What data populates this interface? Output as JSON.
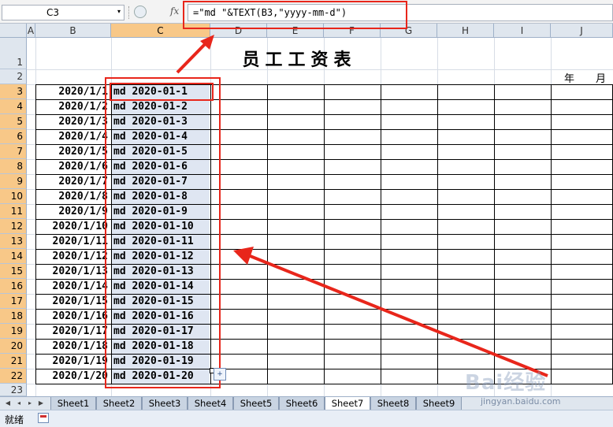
{
  "formula_bar": {
    "cell_ref": "C3",
    "dropdown_glyph": "▾",
    "fx_label": "fx",
    "formula": "=\"md \"&TEXT(B3,\"yyyy-mm-d\")"
  },
  "columns": [
    "A",
    "B",
    "C",
    "D",
    "E",
    "F",
    "G",
    "H",
    "I",
    "J"
  ],
  "selected_column": "C",
  "rows": [
    "1",
    "2",
    "3",
    "4",
    "5",
    "6",
    "7",
    "8",
    "9",
    "10",
    "11",
    "12",
    "13",
    "14",
    "15",
    "16",
    "17",
    "18",
    "19",
    "20",
    "21",
    "22",
    "23"
  ],
  "sheet": {
    "title": "员工工资表",
    "year_month_labels": [
      "年",
      "月"
    ],
    "dates": [
      "2020/1/1",
      "2020/1/2",
      "2020/1/3",
      "2020/1/4",
      "2020/1/5",
      "2020/1/6",
      "2020/1/7",
      "2020/1/8",
      "2020/1/9",
      "2020/1/10",
      "2020/1/11",
      "2020/1/12",
      "2020/1/13",
      "2020/1/14",
      "2020/1/15",
      "2020/1/16",
      "2020/1/17",
      "2020/1/18",
      "2020/1/19",
      "2020/1/20"
    ],
    "formatted": [
      "md 2020-01-1",
      "md 2020-01-2",
      "md 2020-01-3",
      "md 2020-01-4",
      "md 2020-01-5",
      "md 2020-01-6",
      "md 2020-01-7",
      "md 2020-01-8",
      "md 2020-01-9",
      "md 2020-01-10",
      "md 2020-01-11",
      "md 2020-01-12",
      "md 2020-01-13",
      "md 2020-01-14",
      "md 2020-01-15",
      "md 2020-01-16",
      "md 2020-01-17",
      "md 2020-01-18",
      "md 2020-01-19",
      "md 2020-01-20"
    ]
  },
  "tabs": [
    "Sheet1",
    "Sheet2",
    "Sheet3",
    "Sheet4",
    "Sheet5",
    "Sheet6",
    "Sheet7",
    "Sheet8",
    "Sheet9"
  ],
  "active_tab": "Sheet7",
  "nav_buttons": [
    "first-sheet-icon",
    "prev-sheet-icon",
    "next-sheet-icon",
    "last-sheet-icon"
  ],
  "status": {
    "ready": "就绪"
  },
  "watermark": {
    "logo": "Baidu 经验",
    "url": "jingyan.baidu.com"
  },
  "colors": {
    "annotation_red": "#e8261b",
    "selected_header": "#f8c888",
    "selected_fill": "#dfe6f2"
  }
}
